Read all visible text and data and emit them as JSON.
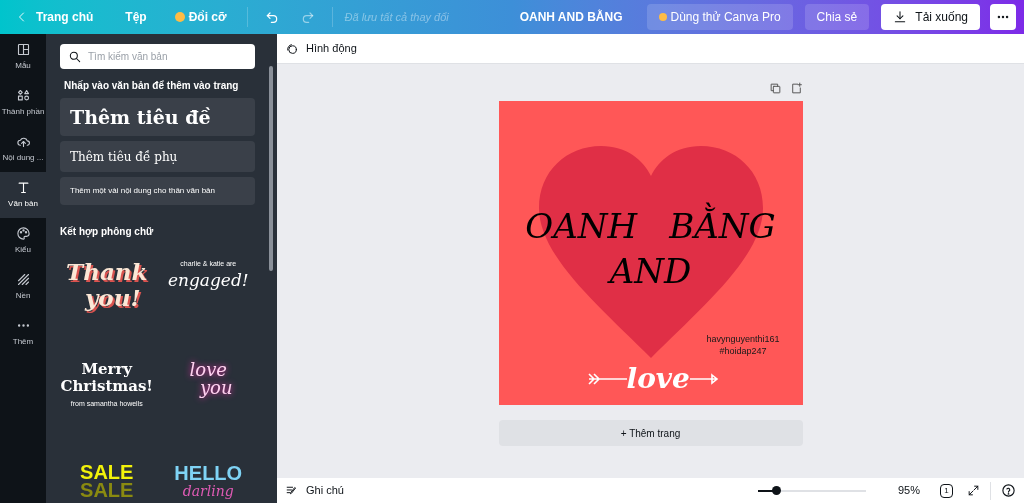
{
  "topbar": {
    "home": "Trang chủ",
    "file": "Tệp",
    "resize": "Đổi cỡ",
    "save_status": "Đã lưu tất cả thay đổi",
    "title": "OANH AND BẰNG",
    "pro": "Dùng thử Canva Pro",
    "share": "Chia sẻ",
    "download": "Tải xuống"
  },
  "sidebar": {
    "items": [
      {
        "kind": "template",
        "label": "Mẫu",
        "selected": false
      },
      {
        "kind": "elements",
        "label": "Thành phần",
        "selected": false
      },
      {
        "kind": "upload",
        "label": "Nội dung ...",
        "selected": false
      },
      {
        "kind": "text",
        "label": "Văn bản",
        "selected": true
      },
      {
        "kind": "style",
        "label": "Kiểu",
        "selected": false
      },
      {
        "kind": "background",
        "label": "Nền",
        "selected": false
      },
      {
        "kind": "more",
        "label": "Thêm",
        "selected": false
      }
    ]
  },
  "panel": {
    "search": {
      "placeholder": "Tìm kiếm văn bản"
    },
    "hint": "Nhấp vào văn bản để thêm vào trang",
    "presets": [
      {
        "kind": "heading",
        "label": "Thêm tiêu đề"
      },
      {
        "kind": "subheading",
        "label": "Thêm tiêu đề phụ"
      },
      {
        "kind": "body",
        "label": "Thêm một vài nội dung cho thân văn bản"
      }
    ],
    "pairings_title": "Kết hợp phông chữ",
    "pairings": [
      {
        "kind": "thankyou",
        "lines": [
          "Thank",
          "you!"
        ]
      },
      {
        "kind": "engaged",
        "lines": [
          "charlie & katie are",
          "engaged!"
        ]
      },
      {
        "kind": "christmas",
        "lines": [
          "Merry",
          "Christmas!",
          "from samantha howells"
        ]
      },
      {
        "kind": "neon",
        "lines": [
          "love",
          "you"
        ]
      },
      {
        "kind": "sale",
        "lines": [
          "SALE",
          "SALE"
        ]
      },
      {
        "kind": "hello",
        "lines": [
          "HELLO",
          "darling"
        ]
      }
    ]
  },
  "toolbar": {
    "animate": "Hình động"
  },
  "design": {
    "names": [
      "OANH",
      "BẰNG",
      "AND"
    ],
    "credit": [
      "havynguyenthi161",
      "#hoidap247"
    ],
    "love": "love"
  },
  "add_page": "+ Thêm trang",
  "bottombar": {
    "notes": "Ghi chú",
    "zoom": {
      "level": 0.17
    },
    "zoom_reading": "95%",
    "page_count": "1"
  }
}
